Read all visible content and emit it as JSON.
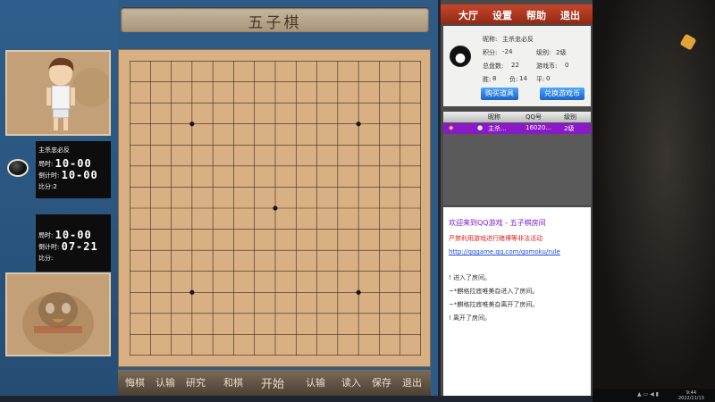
{
  "window": {
    "title": "五子棋"
  },
  "player_top": {
    "name": "主杀忠必反",
    "time_label": "局时:",
    "time_value": "10-00",
    "countdown_label": "倒计时:",
    "countdown_value": "10-00",
    "score_label": "比分:",
    "score_value": "2"
  },
  "player_bottom": {
    "time_label": "局时:",
    "time_value": "10-00",
    "countdown_label": "倒计时:",
    "countdown_value": "07-21",
    "score_label": "比分:",
    "score_value": ""
  },
  "board": {
    "size": 15,
    "star_points": [
      [
        3,
        3
      ],
      [
        3,
        11
      ],
      [
        7,
        7
      ],
      [
        11,
        3
      ],
      [
        11,
        11
      ]
    ]
  },
  "bottom_buttons": {
    "b1": "悔棋",
    "b2": "认输",
    "b3": "研究",
    "b4": "和棋",
    "b5": "开始",
    "b6": "认输",
    "b7": "读入",
    "b8": "保存",
    "b9": "退出"
  },
  "menu": {
    "lobby": "大厅",
    "settings": "设置",
    "help": "帮助",
    "exit": "退出"
  },
  "profile": {
    "nickname_label": "昵称:",
    "nickname": "主杀忠必反",
    "points_label": "积分:",
    "points": "-24",
    "level_label": "级别:",
    "level": "2级",
    "total_label": "总盘数:",
    "total": "22",
    "coins_label": "游戏币:",
    "coins": "0",
    "win_label": "胜:",
    "win": "8",
    "lose_label": "负:",
    "lose": "14",
    "draw_label": "平:",
    "draw": "0",
    "buy_button": "购买道具",
    "exchange_button": "兑换游戏币"
  },
  "user_table": {
    "headers": [
      "昵称",
      "QQ号",
      "级别"
    ],
    "row": {
      "nickname": "主杀...",
      "qq": "16020...",
      "level": "2级"
    }
  },
  "chat": {
    "welcome": "欢迎来到QQ游戏 - 五子棋房间",
    "notice": "严禁利用游戏进行赌博等非法活动",
    "link": "http://qqgame.qq.com/gomoku/rule",
    "line1": "! 进入了房间。",
    "line2": "~*麒格拉底唯美旮进入了房间。",
    "line3": "~*麒格拉底唯美旮离开了房间。",
    "line4": "! 离开了房间。"
  },
  "taskbar": {
    "time": "9:44",
    "date": "2022/11/13"
  },
  "colors": {
    "board": "#d9b083",
    "menu": "#b23a22",
    "highlight_row": "#8a19c7"
  }
}
